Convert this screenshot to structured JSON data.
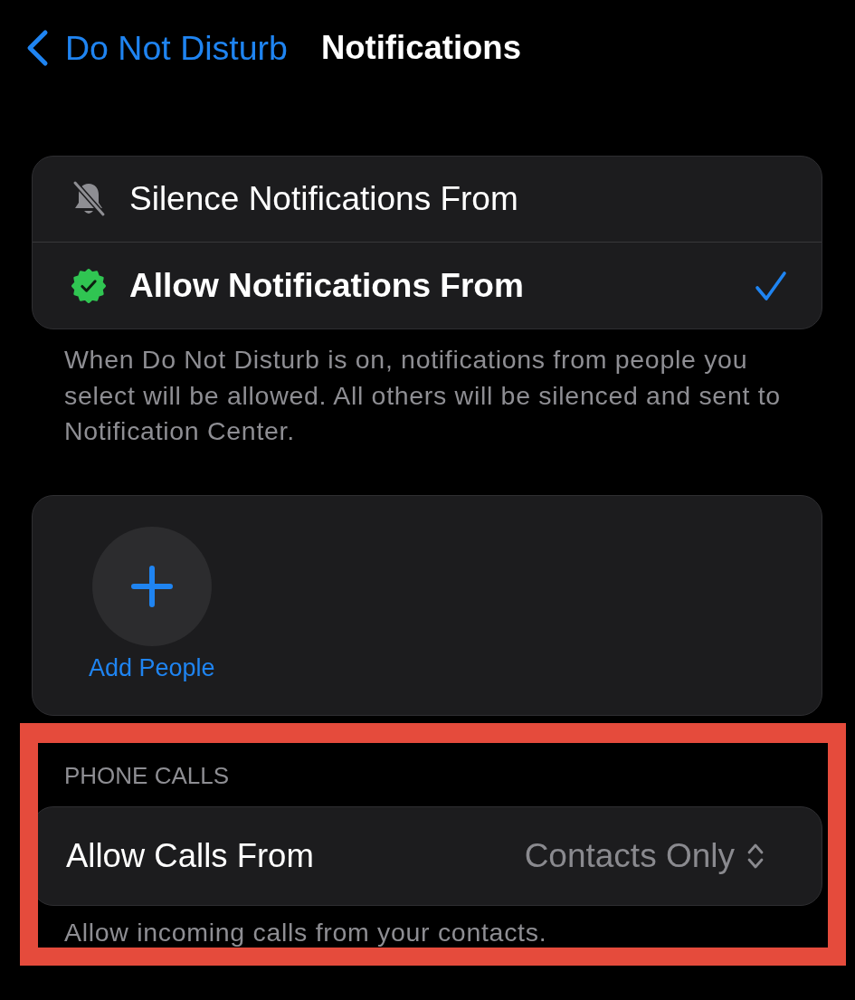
{
  "nav": {
    "back_label": "Do Not Disturb",
    "title": "Notifications"
  },
  "mode_options": [
    {
      "kind": "silence",
      "label": "Silence Notifications From",
      "selected": false
    },
    {
      "kind": "allow",
      "label": "Allow Notifications From",
      "selected": true
    }
  ],
  "mode_footer": "When Do Not Disturb is on, notifications from people you select will be allowed. All others will be silenced and sent to Notification Center.",
  "people": {
    "add_label": "Add People"
  },
  "phone_calls": {
    "highlighted": true,
    "header": "PHONE CALLS",
    "row": {
      "label": "Allow Calls From",
      "value": "Contacts Only"
    },
    "footer": "Allow incoming calls from your contacts."
  }
}
